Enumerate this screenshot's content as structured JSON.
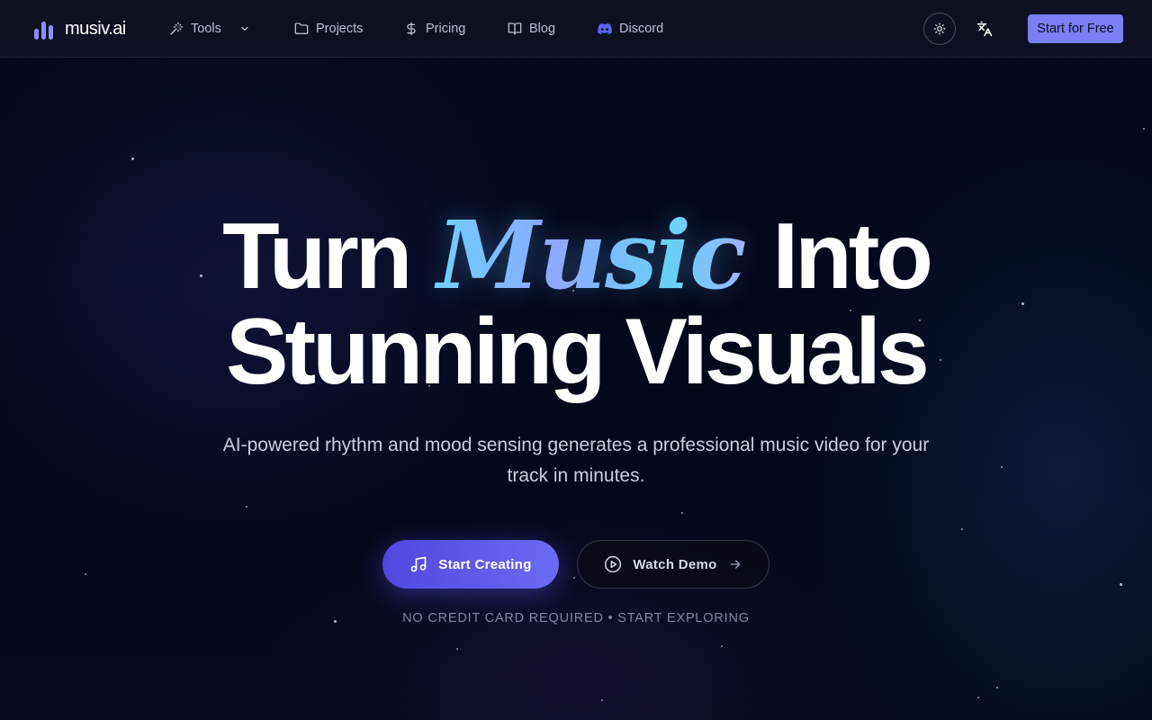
{
  "brand": {
    "name": "musiv.ai"
  },
  "nav": {
    "tools": "Tools",
    "projects": "Projects",
    "pricing": "Pricing",
    "blog": "Blog",
    "discord": "Discord"
  },
  "header": {
    "cta": "Start for Free"
  },
  "hero": {
    "title_part1": "Turn",
    "title_highlight": "Music",
    "title_part2": "Into",
    "title_line2": "Stunning Visuals",
    "subtitle": "AI-powered rhythm and mood sensing generates a professional music video for your track in minutes.",
    "primary_cta": "Start Creating",
    "secondary_cta": "Watch Demo",
    "note": "NO CREDIT CARD REQUIRED • START EXPLORING"
  },
  "colors": {
    "accent": "#7b7ff5",
    "primary_button": "#5a55e8",
    "discord": "#5865f2",
    "background": "#050816"
  }
}
